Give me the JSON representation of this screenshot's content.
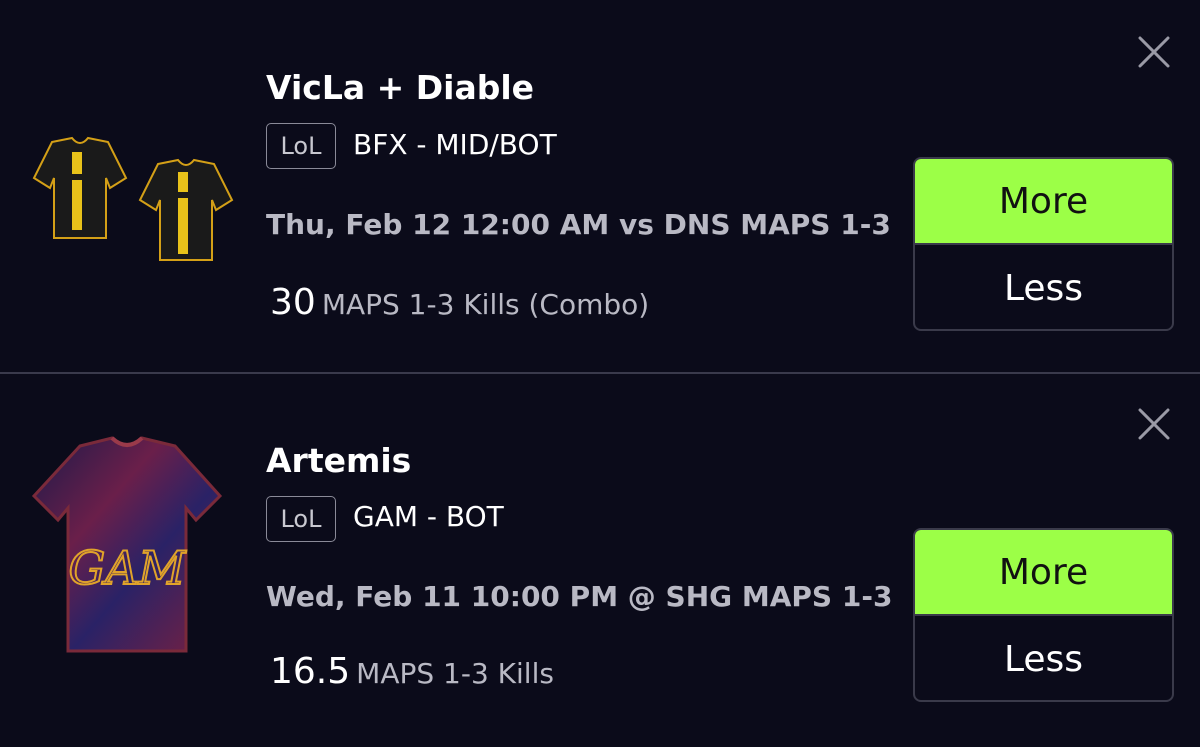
{
  "cards": [
    {
      "player_name": "VicLa + Diable",
      "league": "LoL",
      "team_position": "BFX - MID/BOT",
      "game_info": "Thu, Feb 12 12:00 AM vs DNS MAPS 1-3",
      "line_value": "30",
      "stat_label": "MAPS 1-3 Kills (Combo)",
      "more_label": "More",
      "less_label": "Less",
      "jersey": "two black-and-gold jerseys"
    },
    {
      "player_name": "Artemis",
      "league": "LoL",
      "team_position": "GAM - BOT",
      "game_info": "Wed, Feb 11 10:00 PM @ SHG MAPS 1-3",
      "line_value": "16.5",
      "stat_label": "MAPS 1-3 Kills",
      "more_label": "More",
      "less_label": "Less",
      "jersey": "purple-red gradient jersey with gold GAM logo"
    }
  ],
  "colors": {
    "background": "#0b0b1a",
    "more_button": "#9cff47",
    "divider": "#3a3a4c",
    "secondary_text": "#b9b9c4"
  },
  "icons": [
    "close-icon",
    "jersey-icon"
  ]
}
